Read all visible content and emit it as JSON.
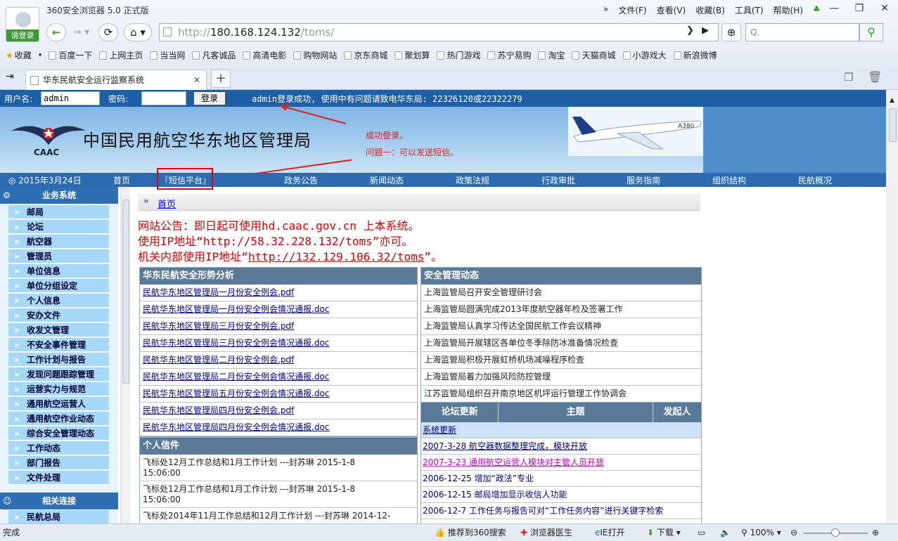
{
  "browser": {
    "title": "360安全浏览器 5.0 正式版",
    "login_label": "请登录",
    "menu": [
      "文件(F)",
      "查看(V)",
      "收藏(B)",
      "工具(T)",
      "帮助(H)"
    ],
    "url_prefix": "http://",
    "url_host": "180.168.124.132",
    "url_path": "/toms/",
    "search_placeholder": "Q.",
    "favorites_label": "收藏",
    "bookmarks": [
      "百度一下",
      "上网主页",
      "当当网",
      "凡客诚品",
      "高清电影",
      "购物网站",
      "京东商城",
      "聚划算",
      "热门游戏",
      "苏宁易购",
      "淘宝",
      "天猫商城",
      "小游戏大",
      "新浪微博"
    ],
    "tab_title": "华东民航安全运行监察系统",
    "tab_add": "+",
    "tab_close": "✕"
  },
  "loginbar": {
    "username_label": "用户名:",
    "username_value": "admin",
    "password_label": "密码:",
    "login_button": "登录",
    "message": "admin登录成功, 使用中有问题请致电华东局: 22326120或22322279"
  },
  "banner": {
    "title": "中国民用航空华东地区管理局",
    "logo_text": "CAAC",
    "plane_text": "A380"
  },
  "annotations": {
    "note1": "成功登录。",
    "note2": "问题一：可以发送短信。"
  },
  "nav": {
    "date": "◎ 2015年3月24日",
    "items": [
      "首页",
      "『短信平台』",
      "政务公告",
      "新闻动态",
      "政策法规",
      "行政审批",
      "服务指南",
      "组织结构",
      "民航概况"
    ]
  },
  "sidebar": {
    "header": "业务系统",
    "items": [
      "邮局",
      "论坛",
      "航空器",
      "管理员",
      "单位信息",
      "单位分组设定",
      "个人信息",
      "安办文件",
      "收发文管理",
      "不安全事件管理",
      "工作计划与报告",
      "发现问题跟踪管理",
      "运营实力与规范",
      "通用航空运营人",
      "通用航空作业动态",
      "综合安全管理动态",
      "工作动态",
      "部门报告",
      "文件处理"
    ],
    "header2": "相关连接",
    "links": [
      "民航总局"
    ]
  },
  "breadcrumb": "首页",
  "notices": [
    "网站公告：即日起可使用hd.caac.gov.cn 上本系统。",
    "使用IP地址“http://58.32.228.132/toms”亦可。"
  ],
  "notice3_prefix": "机关内部使用IP地址“",
  "notice3_link": "http://132.129.106.32/toms",
  "notice3_suffix": "”。",
  "safety_analysis": {
    "title": "华东民航安全形势分析",
    "items": [
      "民航华东地区管理局一月份安全例会.pdf",
      "民航华东地区管理局一月份安全例会情况通报.doc",
      "民航华东地区管理局三月份安全例会.pdf",
      "民航华东地区管理局三月份安全例会情况通报.doc",
      "民航华东地区管理局二月份安全例会.pdf",
      "民航华东地区管理局二月份安全例会情况通报.doc",
      "民航华东地区管理局五月份安全例会情况通报.doc",
      "民航华东地区管理局四月份安全例会.pdf",
      "民航华东地区管理局四月份安全例会情况通报.doc"
    ]
  },
  "personal_mail": {
    "title": "个人信件",
    "items": [
      {
        "line1": "飞标处12月工作总结和1月工作计划 ---封苏琳 2015-1-8",
        "line2": "15:06:00"
      },
      {
        "line1": "飞标处12月工作总结和1月工作计划 ---封苏琳 2015-1-8",
        "line2": "15:06:00"
      },
      {
        "line1": "飞标处2014年11月工作总结和12月工作计划 ---封苏琳 2014-12-",
        "line2": ""
      }
    ]
  },
  "safety_news": {
    "title": "安全管理动态",
    "items": [
      "上海监管局召开安全管理研讨会",
      "上海监管局圆满完成2013年度航空器年检及签署工作",
      "上海监管局认真学习传达全国民航工作会议精神",
      "上海监管局开展辖区各单位冬季除防冰准备情况检查",
      "上海监管局积极开展虹桥机场减噪程序检查",
      "上海监管局着力加强风险防控管理",
      "江苏监管局组织召开南京地区机坪运行管理工作协调会"
    ]
  },
  "forum": {
    "columns": [
      "论坛更新",
      "主题",
      "发起人"
    ],
    "first": "系统更新",
    "items": [
      "2007-3-28 航空器数据整理完成，模块开放",
      "2007-3-23 通用航空运营人模块对主管人员开放",
      "2006-12-25 增加“政法”专业",
      "2006-12-15 邮局增加显示收信人功能",
      "2006-12-7 工作任务与报告可对“工作任务内容”进行关键字检索"
    ]
  },
  "status": {
    "left": "完成",
    "recommend": "推荐到360搜索",
    "doctor": "浏览器医生",
    "ie": "IE打开",
    "download": "下载",
    "zoom": "100%"
  }
}
